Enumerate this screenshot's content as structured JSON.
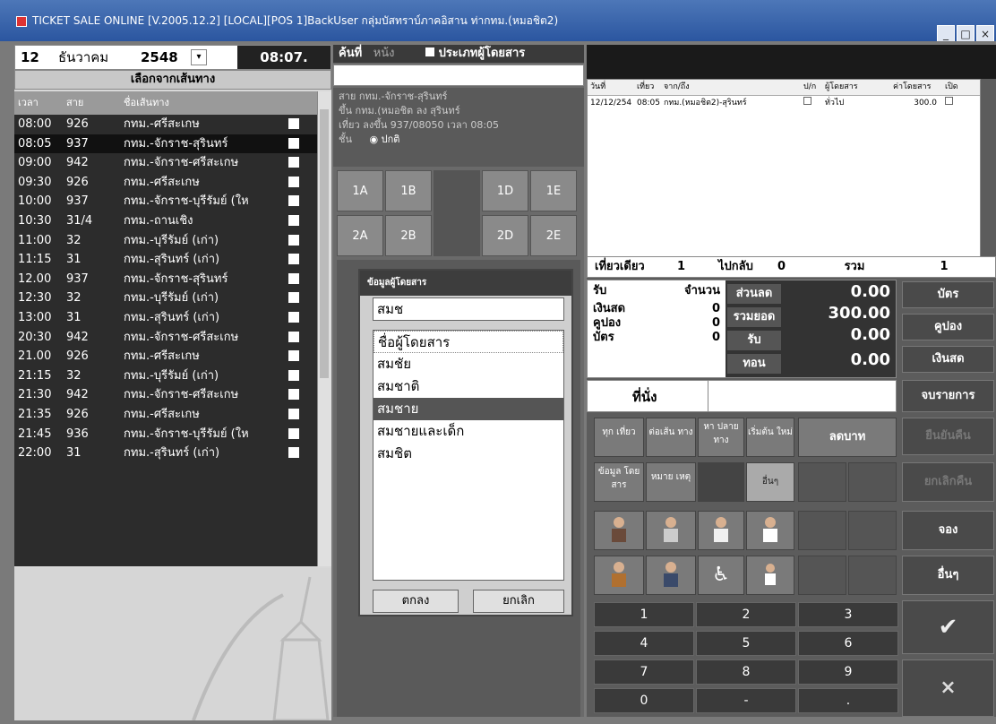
{
  "window": {
    "title": "TICKET SALE ONLINE [V.2005.12.2] [LOCAL][POS 1]BackUser กลุ่มบัสทราบ์ภาคอิสาน ท่ากทม.(หมอชิต2)"
  },
  "left": {
    "day": "12",
    "month": "ธันวาคม",
    "year": "2548",
    "time": "08:07.",
    "route_button": "เลือกจากเส้นทาง",
    "headers": [
      "เวลา",
      "สาย",
      "ชื่อเส้นทาง"
    ],
    "rows": [
      {
        "time": "08:00",
        "line": "926",
        "route": "กทม.-ศรีสะเกษ"
      },
      {
        "time": "08:05",
        "line": "937",
        "route": "กทม.-จักราช-สุรินทร์"
      },
      {
        "time": "09:00",
        "line": "942",
        "route": "กทม.-จักราช-ศรีสะเกษ"
      },
      {
        "time": "09:30",
        "line": "926",
        "route": "กทม.-ศรีสะเกษ"
      },
      {
        "time": "10:00",
        "line": "937",
        "route": "กทม.-จักราช-บุรีรัมย์ (ให"
      },
      {
        "time": "10:30",
        "line": "31/4",
        "route": "กทม.-ถานเชิง"
      },
      {
        "time": "11:00",
        "line": "32",
        "route": "กทม.-บุรีรัมย์ (เก่า)"
      },
      {
        "time": "11:15",
        "line": "31",
        "route": "กทม.-สุรินทร์ (เก่า)"
      },
      {
        "time": "12.00",
        "line": "937",
        "route": "กทม.-จักราช-สุรินทร์"
      },
      {
        "time": "12:30",
        "line": "32",
        "route": "กทม.-บุรีรัมย์ (เก่า)"
      },
      {
        "time": "13:00",
        "line": "31",
        "route": "กทม.-สุรินทร์ (เก่า)"
      },
      {
        "time": "20:30",
        "line": "942",
        "route": "กทม.-จักราช-ศรีสะเกษ"
      },
      {
        "time": "21.00",
        "line": "926",
        "route": "กทม.-ศรีสะเกษ"
      },
      {
        "time": "21:15",
        "line": "32",
        "route": "กทม.-บุรีรัมย์ (เก่า)"
      },
      {
        "time": "21:30",
        "line": "942",
        "route": "กทม.-จักราช-ศรีสะเกษ"
      },
      {
        "time": "21:35",
        "line": "926",
        "route": "กทม.-ศรีสะเกษ"
      },
      {
        "time": "21:45",
        "line": "936",
        "route": "กทม.-จักราช-บุรีรัมย์ (ให"
      },
      {
        "time": "22:00",
        "line": "31",
        "route": "กทม.-สุรินทร์ (เก่า)"
      }
    ]
  },
  "middle": {
    "search_label": "ค้นที่",
    "search_opt": "หน้ง",
    "passenger_type_label": "ประเภทผู้โดยสาร",
    "info_line1": "สาย กทม.-จักราช-สุรินทร์",
    "info_line2": "ขึ้น กทม.(หมอชิต ลง สุรินทร์",
    "info_line3": "เที่ยว ลงขึ้น 937/08050 เวลา 08:05",
    "info_line4": "ชั้น",
    "info_class": "ปกติ",
    "seats": [
      "1A",
      "1B",
      "1D",
      "1E",
      "2A",
      "2B",
      "2D",
      "2E"
    ]
  },
  "dialog": {
    "title": "ข้อมูลผู้โดยสาร",
    "input": "สมช",
    "items": [
      "ชื่อผู้โดยสาร",
      "สมชัย",
      "สมชาติ",
      "สมชาย",
      "สมชายและเด็ก",
      "สมชิต"
    ],
    "ok": "ตกลง",
    "cancel": "ยกเลิก"
  },
  "right": {
    "grid_headers": [
      "วันที่",
      "เที่ยว",
      "จาก/ถึง",
      "ป/ก",
      "ผู้โดยสาร",
      "ค่าโดยสาร",
      "เปิด"
    ],
    "grid_row": {
      "date": "12/12/254",
      "trip": "08:05",
      "route": "กทม.(หมอชิต2)-สุรินทร์",
      "pax": "ทั่วไป",
      "fare": "300.0"
    },
    "single_label": "เที่ยวเดียว",
    "single_count": "1",
    "return_label": "ไปกลับ",
    "return_count": "0",
    "total_label": "รวม",
    "total_count": "1",
    "receive_label": "รับ",
    "amount_label": "จำนวน",
    "cash_label": "เงินสด",
    "cash_val": "0",
    "coupon_label": "คูปอง",
    "coupon_val": "0",
    "card_label": "บัตร",
    "card_val": "0",
    "discount_label": "ส่วนลด",
    "discount_val": "0.00",
    "sum_label": "รวมยอด",
    "sum_val": "300.00",
    "recv_label": "รับ",
    "recv_val": "0.00",
    "change_label": "ทอน",
    "change_val": "0.00",
    "seat_label": "ที่นั่ง",
    "btn_card": "บัตร",
    "btn_coupon": "คูปอง",
    "btn_cash": "เงินสด",
    "btn_done": "จบรายการ",
    "btn_book": "จอง",
    "btn_other": "อื่นๆ",
    "btn_dim1": "ยืนยันคืน",
    "btn_dim2": "ยกเลิกคืน",
    "tile_trip": "ทุก เที่ยว",
    "tile_path": "ต่อเส้น ทาง",
    "tile_dest": "หา ปลาย ทาง",
    "tile_new": "เริ่มต้น ใหม่",
    "tile_discount": "ลดบาท",
    "tile_pax": "ข้อมูล โดย สาร",
    "tile_note": "หมาย เหตุ",
    "tile_etc": "อื่นๆ",
    "keys": [
      "1",
      "2",
      "3",
      "4",
      "5",
      "6",
      "7",
      "8",
      "9",
      "0",
      "-",
      "."
    ],
    "ok_icon": "check-icon",
    "cancel_icon": "x-icon"
  }
}
